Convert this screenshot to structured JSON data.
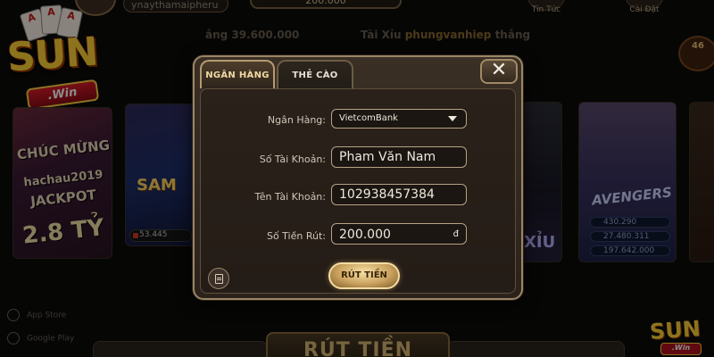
{
  "background": {
    "username": "ynaythamaipheru",
    "balance": "200.000",
    "top_buttons": [
      "Tin Tức",
      "Cài Đặt"
    ],
    "ticker": {
      "message1": "ắng 39.600.000",
      "message2_prefix": "Tài Xỉu",
      "message2_name": "phungvanhiep",
      "message2_suffix": "thắng"
    },
    "logo": {
      "brand": "SUN",
      "ribbon": ".Win"
    },
    "jackpot_card": {
      "line1": "CHÚC MỪNG",
      "line2": "hachau2019",
      "line3": "JACKPOT",
      "amount": "2.8 TỶ"
    },
    "sam_card": {
      "title": "SAM",
      "jackpot": "53.445"
    },
    "xiu_card": {
      "title": "XỈU"
    },
    "avengers_card": {
      "title": "AVENGERS",
      "values": [
        "430.290",
        "27.480.311",
        "197.642.000"
      ]
    },
    "badge": "46",
    "store_links": [
      "App Store",
      "Google Play"
    ],
    "bottom_title": "RÚT TIỀN",
    "mini_logo": {
      "brand": "SUN",
      "ribbon": ".Win"
    }
  },
  "modal": {
    "tabs": {
      "bank": "NGÂN HÀNG",
      "card": "THẺ CÀO"
    },
    "close_symbol": "✕",
    "labels": {
      "bank": "Ngân Hàng:",
      "account_number": "Số Tài Khoản:",
      "account_name": "Tên Tài Khoản:",
      "amount": "Số Tiền Rút:"
    },
    "fields": {
      "bank_selected": "VietcomBank",
      "account_number_value": "Pham Văn Nam",
      "account_name_value": "102938457384",
      "amount_value": "200.000",
      "currency": "đ"
    },
    "submit_label": "RÚT TIỀN",
    "icons": {
      "history": "receipt-icon",
      "dropdown": "chevron-down-icon",
      "close": "close-icon"
    }
  }
}
